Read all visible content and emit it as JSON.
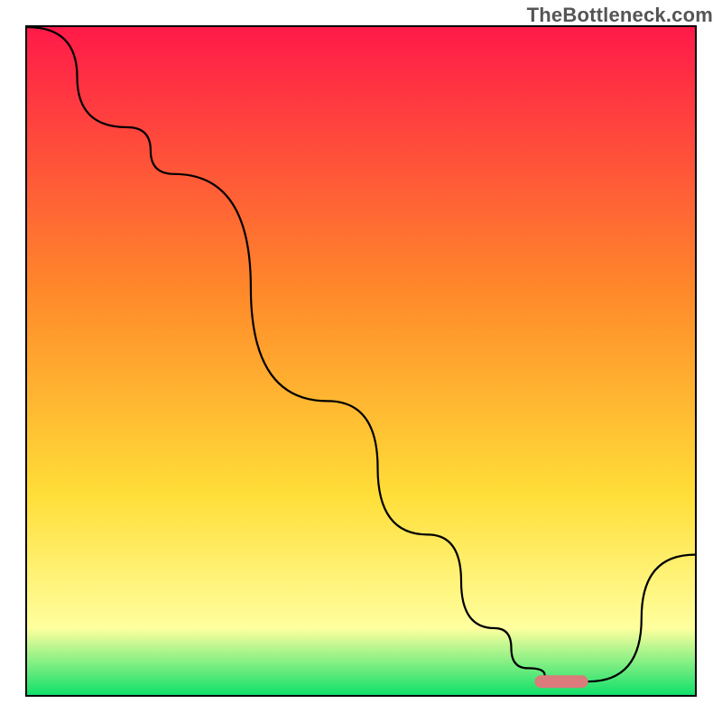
{
  "attribution": "TheBottleneck.com",
  "colors": {
    "gradient_top": "#ff1a49",
    "gradient_mid": "#ffde38",
    "gradient_low_yellow": "#ffff9e",
    "gradient_bottom": "#10e06a",
    "curve": "#000000",
    "marker": "#db7b7b"
  },
  "chart_data": {
    "type": "line",
    "title": "",
    "xlabel": "",
    "ylabel": "",
    "xlim": [
      0,
      100
    ],
    "ylim": [
      0,
      100
    ],
    "series": [
      {
        "name": "bottleneck-curve",
        "x": [
          0,
          15,
          22,
          45,
          60,
          70,
          75,
          80,
          84,
          100
        ],
        "values": [
          100,
          85,
          78,
          44,
          24,
          10,
          4,
          2,
          2,
          21
        ]
      }
    ],
    "annotations": [
      {
        "name": "optimal-range-marker",
        "x_range": [
          76,
          84
        ],
        "y": 2
      }
    ]
  }
}
